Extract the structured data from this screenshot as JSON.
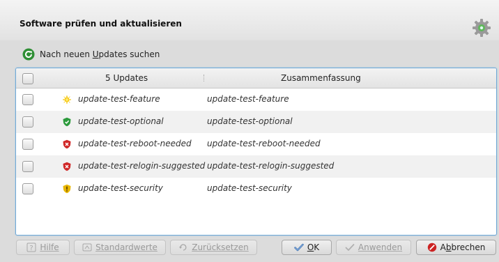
{
  "window": {
    "title": "Software prüfen und aktualisieren"
  },
  "toolbar": {
    "check_updates_pre": "Nach neuen ",
    "check_updates_accel": "U",
    "check_updates_post": "pdates suchen"
  },
  "table": {
    "header_count": "5 Updates",
    "header_summary": "Zusammenfassung",
    "rows": [
      {
        "name": "update-test-feature",
        "summary": "update-test-feature",
        "icon": "enhancement-icon"
      },
      {
        "name": "update-test-optional",
        "summary": "update-test-optional",
        "icon": "optional-icon"
      },
      {
        "name": "update-test-reboot-needed",
        "summary": "update-test-reboot-needed",
        "icon": "important-icon"
      },
      {
        "name": "update-test-relogin-suggested",
        "summary": "update-test-relogin-suggested",
        "icon": "important-icon"
      },
      {
        "name": "update-test-security",
        "summary": "update-test-security",
        "icon": "security-icon"
      }
    ]
  },
  "buttons": {
    "help": "Hilfe",
    "defaults": "Standardwerte",
    "reset": "Zurücksetzen",
    "ok_accel": "O",
    "ok_rest": "K",
    "apply": "Anwenden",
    "cancel_pre": "A",
    "cancel_accel": "b",
    "cancel_post": "brechen"
  },
  "colors": {
    "accent": "#6fa8d6",
    "enhancement": "#f5c400",
    "optional": "#2c9a3c",
    "important": "#d02828",
    "security": "#e8b600"
  }
}
